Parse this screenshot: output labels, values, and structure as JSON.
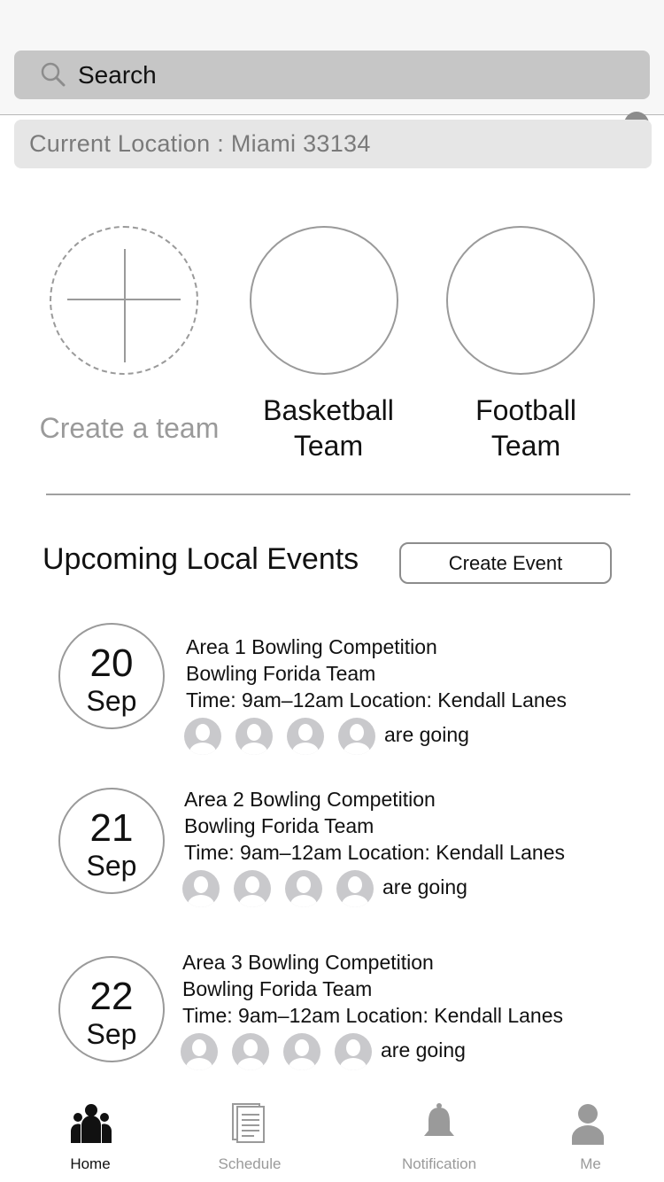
{
  "search": {
    "placeholder": "Search"
  },
  "location": {
    "text": "Current Location : Miami 33134"
  },
  "teams": [
    {
      "label": "Create a team"
    },
    {
      "label_line1": "Basketball",
      "label_line2": "Team"
    },
    {
      "label_line1": "Football",
      "label_line2": "Team"
    }
  ],
  "events_section": {
    "title": "Upcoming Local Events",
    "create_button": "Create Event"
  },
  "events": [
    {
      "day": "20",
      "month": "Sep",
      "title": "Area 1 Bowling Competition",
      "team": "Bowling Forida Team",
      "details": "Time: 9am–12am  Location: Kendall Lanes",
      "going": "are going"
    },
    {
      "day": "21",
      "month": "Sep",
      "title": "Area 2 Bowling Competition",
      "team": "Bowling Forida Team",
      "details": "Time: 9am–12am  Location: Kendall Lanes",
      "going": "are going"
    },
    {
      "day": "22",
      "month": "Sep",
      "title": "Area 3 Bowling Competition",
      "team": "Bowling Forida Team",
      "details": "Time: 9am–12am  Location: Kendall Lanes",
      "going": "are going"
    }
  ],
  "tabbar": {
    "tabs": [
      {
        "label": "Home",
        "icon": "people-icon",
        "active": true
      },
      {
        "label": "Schedule",
        "icon": "document-icon",
        "active": false
      },
      {
        "label": "Notification",
        "icon": "bell-icon",
        "active": false
      },
      {
        "label": "Me",
        "icon": "person-icon",
        "active": false
      }
    ]
  },
  "colors": {
    "active_tab": "#111111",
    "inactive_tab": "#9a9a9a",
    "search_bg": "#c6c6c6",
    "location_bg": "#e6e6e6"
  }
}
